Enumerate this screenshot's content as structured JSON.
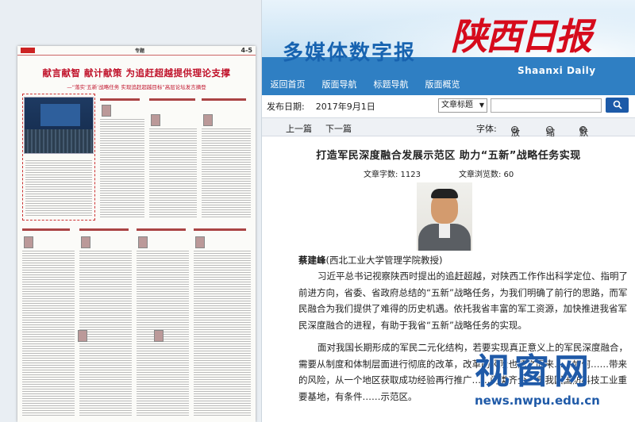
{
  "newspaper_page": {
    "section": "专题",
    "page_no": "4-5",
    "headline": "献言献智  献计献策  为追赶超越提供理论支撑",
    "subhead": "—“落实‘五新’战略任务 实现追赶超越目标”高层论坛发言摘登"
  },
  "header": {
    "site_title": "多媒体数字报",
    "logo_cn": "陕西日报",
    "logo_en": "Shaanxi Daily",
    "nav": [
      "返回首页",
      "版面导航",
      "标题导航",
      "版面概览"
    ]
  },
  "searchbar": {
    "date_label": "发布日期:",
    "date_value": "2017年9月1日",
    "select_value": "文章标题",
    "search_icon": "search-icon"
  },
  "toolbar": {
    "prev": "上一篇",
    "next": "下一篇",
    "font_label": "字体:",
    "zoom_in": "放大",
    "zoom_out": "缩小",
    "default": "默认",
    "plus": "+",
    "minus": "−",
    "circle": "O"
  },
  "article": {
    "title": "打造军民深度融合发展示范区  助力“五新”战略任务实现",
    "word_count": "文章字数: 1123",
    "view_count": "文章浏览数: 60",
    "author_name": "蔡建峰",
    "author_affil": "(西北工业大学管理学院教授)",
    "p1": "习近平总书记视察陕西时提出的追赶超越，对陕西工作作出科学定位、指明了前进方向，省委、省政府总结的“五新”战略任务，为我们明确了前行的思路，而军民融合为我们提供了难得的历史机遇。依托我省丰富的军工资源，加快推进我省军民深度融合的进程，有助于我省“五新”战略任务的实现。",
    "p2": "面对我国长期形成的军民二元化结构，若要实现真正意义上的军民深度融合，需要从制度和体制层面进行彻底的改革，改革的风险也随之而来……如何……带来的风险，从一个地区获取成功经验再行推广……门类齐全，是我国国防科技工业重要基地，有条件……示范区。"
  },
  "watermark": {
    "cn": "视窗网",
    "url": "news.nwpu.edu.cn"
  },
  "colors": {
    "brand_red": "#d60b1c",
    "nav_blue": "#2f7fc3",
    "title_blue": "#1763b0"
  }
}
